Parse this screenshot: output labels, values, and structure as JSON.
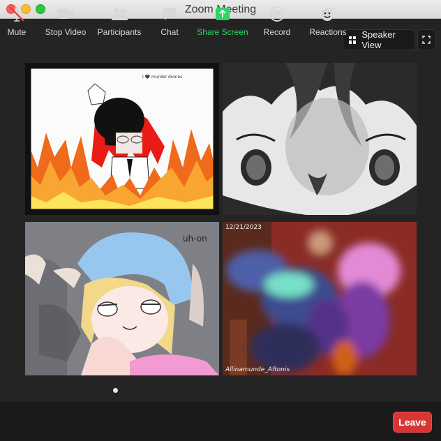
{
  "window": {
    "title": "Zoom Meeting"
  },
  "view": {
    "speaker_view_label": "Speaker View"
  },
  "tiles": [
    {
      "id": "tile-1",
      "caption": "I 🖤 murder drones"
    },
    {
      "id": "tile-2",
      "caption": ""
    },
    {
      "id": "tile-3",
      "caption": "uh-on"
    },
    {
      "id": "tile-4",
      "date": "12/21/2023",
      "signature": "Allinamunde_Aftonis"
    }
  ],
  "toolbar": {
    "mute_label": "Mute",
    "stop_video_label": "Stop Video",
    "participants_label": "Participants",
    "chat_label": "Chat",
    "share_screen_label": "Share Screen",
    "record_label": "Record",
    "reactions_label": "Reactions",
    "leave_label": "Leave"
  },
  "colors": {
    "background": "#242424",
    "toolbar": "#1a1a1a",
    "share_green": "#2bd662",
    "leave_red": "#d93535"
  },
  "icons": [
    "mic-muted-icon",
    "camera-icon",
    "participants-icon",
    "chat-bubble-icon",
    "share-screen-icon",
    "record-icon",
    "reactions-icon",
    "grid-icon",
    "fullscreen-icon"
  ]
}
